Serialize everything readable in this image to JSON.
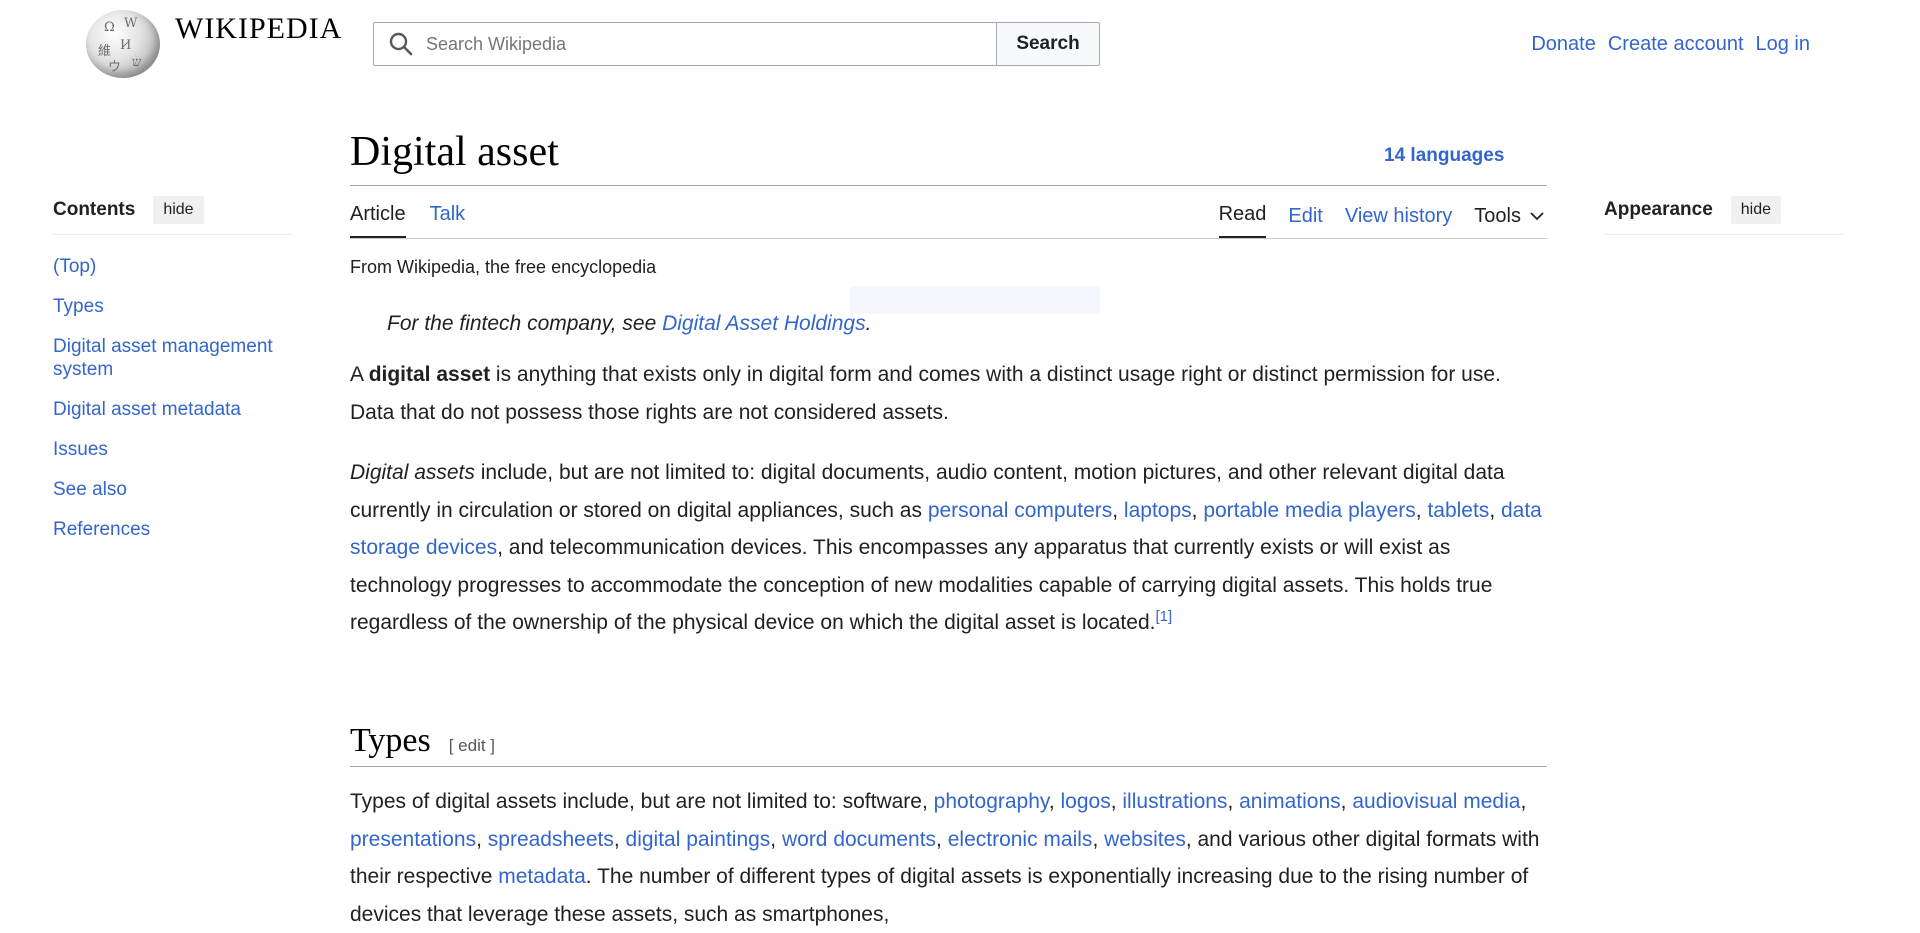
{
  "header": {
    "wordmark": "WIKIPEDIA",
    "search_placeholder": "Search Wikipedia",
    "search_button": "Search",
    "user_links": [
      "Donate",
      "Create account",
      "Log in"
    ]
  },
  "toc": {
    "title": "Contents",
    "hide_label": "hide",
    "items": [
      "(Top)",
      "Types",
      "Digital asset management system",
      "Digital asset metadata",
      "Issues",
      "See also",
      "References"
    ]
  },
  "appearance": {
    "title": "Appearance",
    "hide_label": "hide"
  },
  "article": {
    "title": "Digital asset",
    "languages": "14 languages",
    "tabs_left": [
      "Article",
      "Talk"
    ],
    "tabs_right": [
      "Read",
      "Edit",
      "View history"
    ],
    "tools_label": "Tools",
    "tagline": "From Wikipedia, the free encyclopedia",
    "hatnote_prefix": "For the fintech company, see ",
    "hatnote_link": "Digital Asset Holdings",
    "hatnote_suffix": ".",
    "p1_a": "A ",
    "p1_bold": "digital asset",
    "p1_b": " is anything that exists only in digital form and comes with a distinct usage right or distinct permission for use. Data that do not possess those rights are not considered assets.",
    "p2_italic": "Digital assets",
    "p2_a": " include, but are not limited to: digital documents, audio content, motion pictures, and other relevant digital data currently in circulation or stored on digital appliances, such as ",
    "p2_links": [
      "personal computers",
      "laptops",
      "portable media players",
      "tablets",
      "data storage devices"
    ],
    "p2_b": " and telecommunication devices. This encompasses any apparatus that currently exists or will exist as technology progresses to accommodate the conception of new modalities capable of carrying digital assets. This holds true regardless of the ownership of the physical device on which the digital asset is located.",
    "p2_ref": "[1]",
    "types_heading": "Types",
    "types_edit": "[ edit ]",
    "types_a": "Types of digital assets include, but are not limited to: software, ",
    "types_links": [
      "photography",
      "logos",
      "illustrations",
      "animations",
      "audiovisual media",
      "presentations",
      "spreadsheets",
      "digital paintings",
      "word documents",
      "electronic mails",
      "websites"
    ],
    "types_b": ", and various other digital formats with their respective ",
    "types_link_meta": "metadata",
    "types_c": ". The number of different types of digital assets is exponentially increasing due to the rising number of devices that leverage these assets, such as smartphones,"
  },
  "colors": {
    "link": "#3366cc",
    "text": "#202122",
    "rule": "#a2a9b1"
  }
}
